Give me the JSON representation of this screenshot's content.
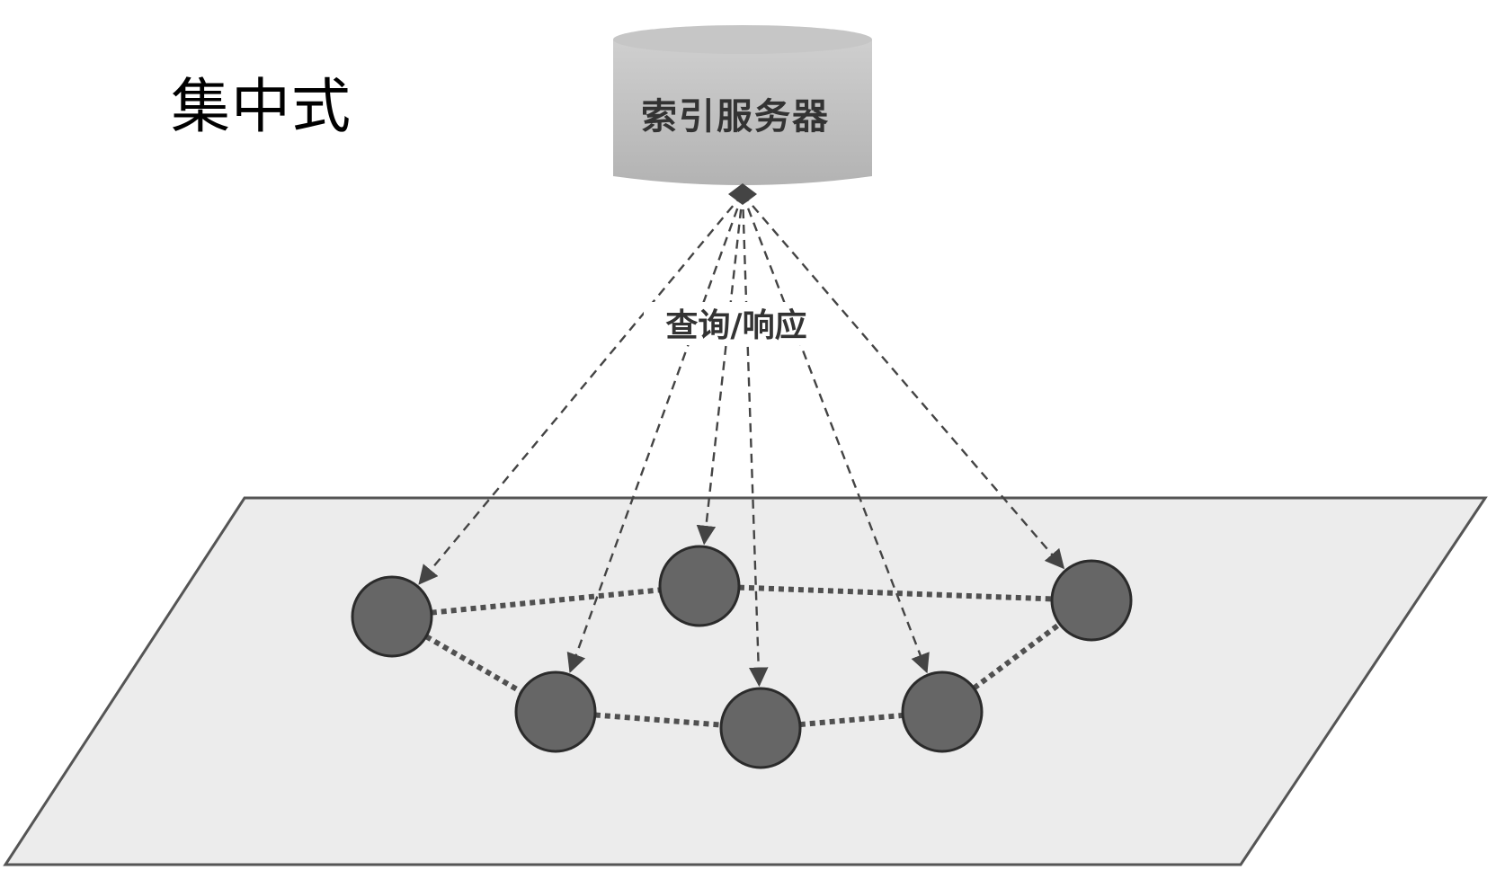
{
  "title": "集中式",
  "server": {
    "label": "索引服务器"
  },
  "edge_label": "查询/响应",
  "peers": [
    {
      "id": "peer-1"
    },
    {
      "id": "peer-2"
    },
    {
      "id": "peer-3"
    },
    {
      "id": "peer-4"
    },
    {
      "id": "peer-5"
    },
    {
      "id": "peer-6"
    }
  ],
  "colors": {
    "background": "#ffffff",
    "plane_fill": "#ececec",
    "plane_stroke": "#555555",
    "server_fill": "#bdbdbd",
    "peer_fill": "#666666",
    "peer_stroke": "#2b2b2b",
    "query_line": "#444444",
    "peer_link": "#505050",
    "text": "#333333"
  }
}
